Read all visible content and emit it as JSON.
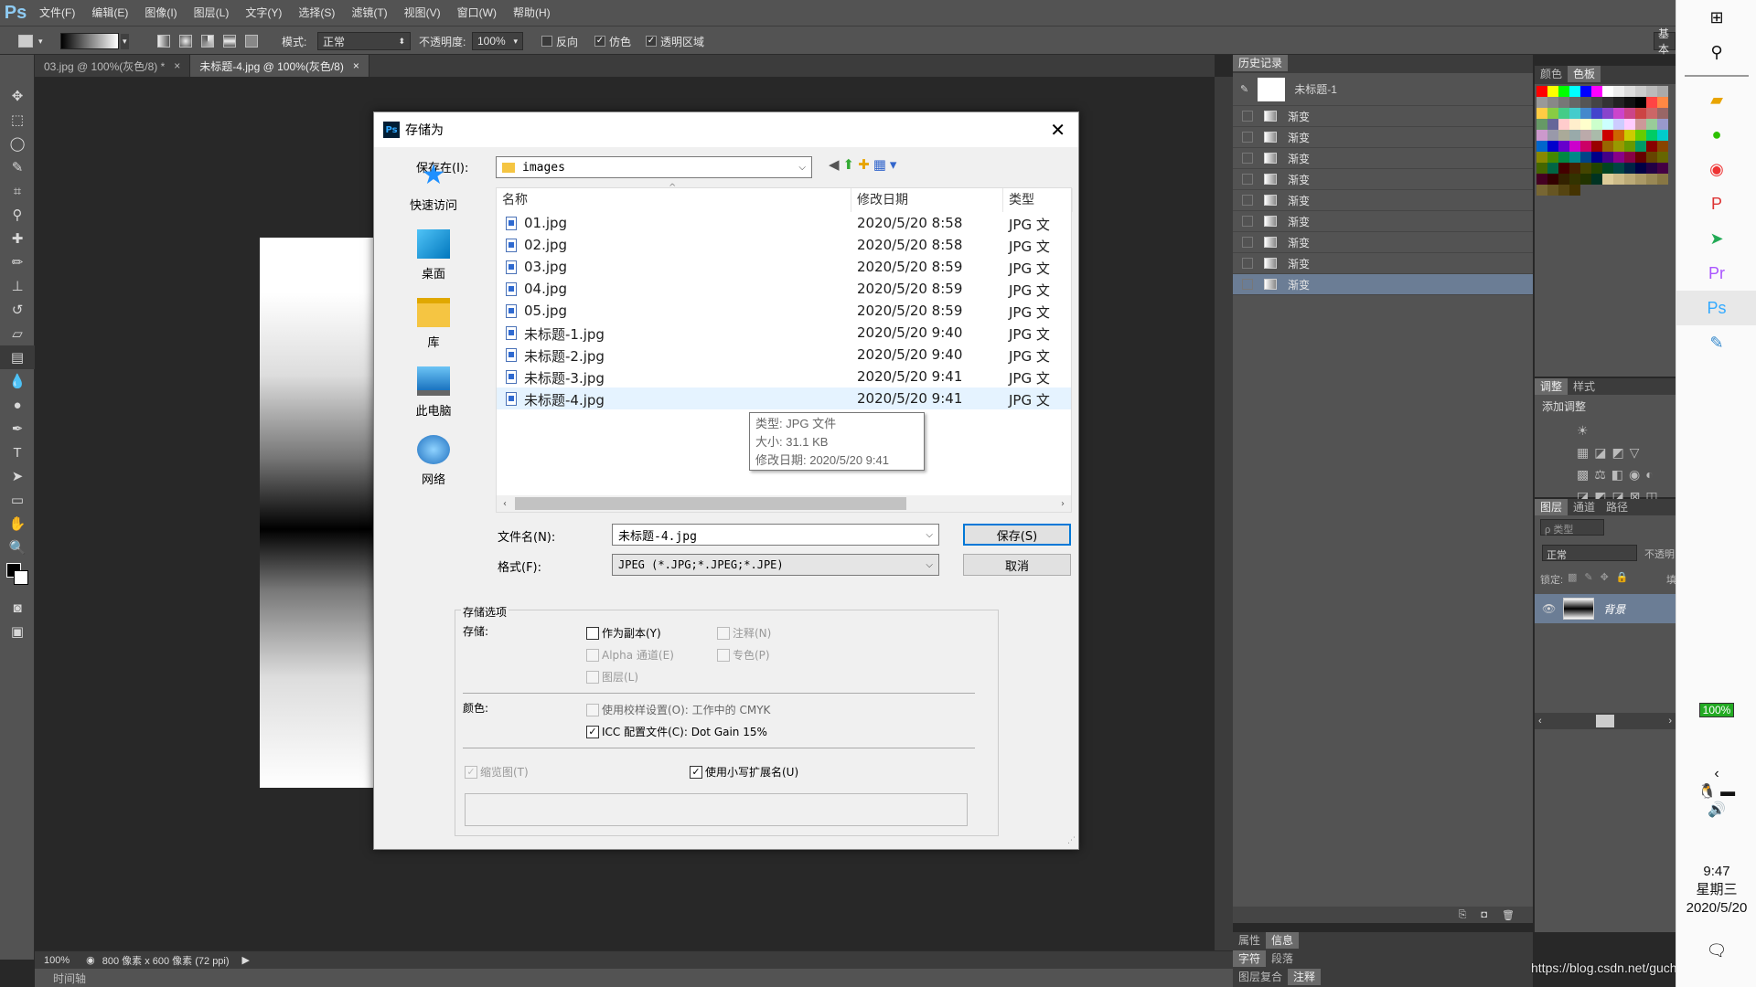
{
  "menubar": {
    "logo": "Ps",
    "items": [
      "文件(F)",
      "编辑(E)",
      "图像(I)",
      "图层(L)",
      "文字(Y)",
      "选择(S)",
      "滤镜(T)",
      "视图(V)",
      "窗口(W)",
      "帮助(H)"
    ]
  },
  "options_bar": {
    "mode_label": "模式:",
    "mode_value": "正常",
    "opacity_label": "不透明度:",
    "opacity_value": "100%",
    "reverse_label": "反向",
    "dither_label": "仿色",
    "transparency_label": "透明区域",
    "workspace_label": "基本"
  },
  "doc_tabs": [
    {
      "label": "03.jpg @ 100%(灰色/8) *"
    },
    {
      "label": "未标题-4.jpg @ 100%(灰色/8)"
    }
  ],
  "status": {
    "zoom": "100%",
    "doc_info": "800 像素 x 600 像素 (72 ppi)",
    "timeline": "时间轴"
  },
  "history_panel": {
    "tab": "历史记录",
    "snapshot": "未标题-1",
    "rows": [
      "渐变",
      "渐变",
      "渐变",
      "渐变",
      "渐变",
      "渐变",
      "渐变",
      "渐变",
      "渐变"
    ]
  },
  "color_panel": {
    "tabs": [
      "颜色",
      "色板"
    ]
  },
  "adjust_panel": {
    "tabs": [
      "调整",
      "样式"
    ],
    "add_label": "添加调整"
  },
  "layers_panel": {
    "tabs": [
      "图层",
      "通道",
      "路径"
    ],
    "filter_label": "ρ 类型",
    "blend_mode": "正常",
    "opacity_label": "不透明",
    "lock_label": "锁定:",
    "fill_label": "填",
    "layer_name": "背景"
  },
  "bottom_panels": {
    "row1": [
      "属性",
      "信息"
    ],
    "row2": [
      "字符",
      "段落"
    ],
    "row3": [
      "图层复合",
      "注释"
    ]
  },
  "taskbar": {
    "battery": "100%",
    "time": "9:47",
    "weekday": "星期三",
    "date": "2020/5/20",
    "watermark": "https://blog.csdn.net/guchengyixin"
  },
  "dialog": {
    "title": "存储为",
    "save_in_label": "保存在(I):",
    "save_in_value": "images",
    "places": [
      "快速访问",
      "桌面",
      "库",
      "此电脑",
      "网络"
    ],
    "columns": [
      "名称",
      "修改日期",
      "类型"
    ],
    "files": [
      {
        "name": "01.jpg",
        "date": "2020/5/20 8:58",
        "type": "JPG 文"
      },
      {
        "name": "02.jpg",
        "date": "2020/5/20 8:58",
        "type": "JPG 文"
      },
      {
        "name": "03.jpg",
        "date": "2020/5/20 8:59",
        "type": "JPG 文"
      },
      {
        "name": "04.jpg",
        "date": "2020/5/20 8:59",
        "type": "JPG 文"
      },
      {
        "name": "05.jpg",
        "date": "2020/5/20 8:59",
        "type": "JPG 文"
      },
      {
        "name": "未标题-1.jpg",
        "date": "2020/5/20 9:40",
        "type": "JPG 文"
      },
      {
        "name": "未标题-2.jpg",
        "date": "2020/5/20 9:40",
        "type": "JPG 文"
      },
      {
        "name": "未标题-3.jpg",
        "date": "2020/5/20 9:41",
        "type": "JPG 文"
      },
      {
        "name": "未标题-4.jpg",
        "date": "2020/5/20 9:41",
        "type": "JPG 文"
      }
    ],
    "tooltip": {
      "type": "类型: JPG 文件",
      "size": "大小: 31.1 KB",
      "modified": "修改日期: 2020/5/20 9:41"
    },
    "filename_label": "文件名(N):",
    "filename_value": "未标题-4.jpg",
    "format_label": "格式(F):",
    "format_value": "JPEG (*.JPG;*.JPEG;*.JPE)",
    "save_button": "保存(S)",
    "cancel_button": "取消",
    "options": {
      "group_title": "存储选项",
      "store_label": "存储:",
      "as_copy": "作为副本(Y)",
      "notes": "注释(N)",
      "alpha": "Alpha 通道(E)",
      "spot": "专色(P)",
      "layers": "图层(L)",
      "color_label": "颜色:",
      "proof": "使用校样设置(O): 工作中的 CMYK",
      "icc": "ICC 配置文件(C): Dot Gain 15%",
      "thumbnail": "缩览图(T)",
      "lowercase": "使用小写扩展名(U)"
    }
  }
}
